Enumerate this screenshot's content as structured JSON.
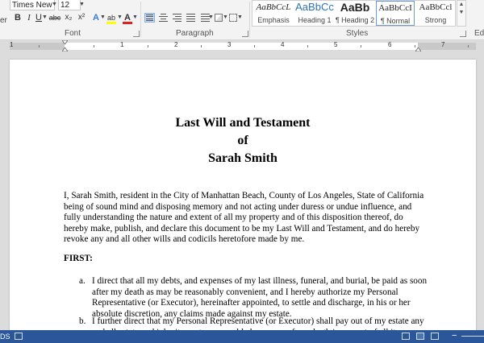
{
  "ribbon": {
    "left_edge_label": "er",
    "font": {
      "name": "Times New R",
      "size": "12",
      "group_label": "Font",
      "buttons": [
        "B",
        "I",
        "U",
        "abc",
        "x₂",
        "x²"
      ],
      "text_effects": "A",
      "highlight": "ab",
      "font_color": "A",
      "highlight_color": "#ffff00",
      "font_color_bar": "#e02020"
    },
    "paragraph": {
      "group_label": "Paragraph"
    },
    "styles": {
      "group_label": "Styles",
      "tiles": [
        {
          "sample": "AaBbCcL",
          "name": "Emphasis"
        },
        {
          "sample": "AaBbCc",
          "name": "Heading 1"
        },
        {
          "sample": "AaBb",
          "name": "¶ Heading 2"
        },
        {
          "sample": "AaBbCcI",
          "name": "¶ Normal"
        },
        {
          "sample": "AaBbCcl",
          "name": "Strong"
        }
      ],
      "heading_color": "#2e74b5"
    },
    "editing": {
      "group_label": "Ed"
    }
  },
  "ruler": {
    "numbers": [
      "1",
      "1",
      "2",
      "3",
      "4",
      "5",
      "6",
      "7"
    ]
  },
  "document": {
    "title_lines": [
      "Last Will and Testament",
      "of",
      "Sarah Smith"
    ],
    "intro_paragraph": "I, Sarah Smith, resident in the City of Manhattan Beach, County of Los Angeles, State of California being of sound mind and disposing memory and not acting under duress or undue influence, and fully understanding the nature and extent of all my property and of this disposition thereof, do hereby make, publish, and declare this document to be my Last Will and Testament, and do hereby revoke any and all other wills and codicils heretofore made by me.",
    "section_heading": "FIRST:",
    "items": [
      {
        "marker": "a.",
        "text": "I direct that all my debts, and expenses of my last illness, funeral, and burial, be paid as soon after my death as may be reasonably convenient, and I hereby authorize my Personal Representative (or Executor), hereinafter appointed, to settle and discharge, in his or her absolute discretion, any claims made against my estate."
      },
      {
        "marker": "b.",
        "text": "I further direct that my Personal Representative (or Executor) shall pay out of my estate any and all estate and inheritance taxes payable by reason of my death in respect of all items included in the computation of such taxes."
      }
    ]
  },
  "statusbar": {
    "left_label": "DS"
  }
}
